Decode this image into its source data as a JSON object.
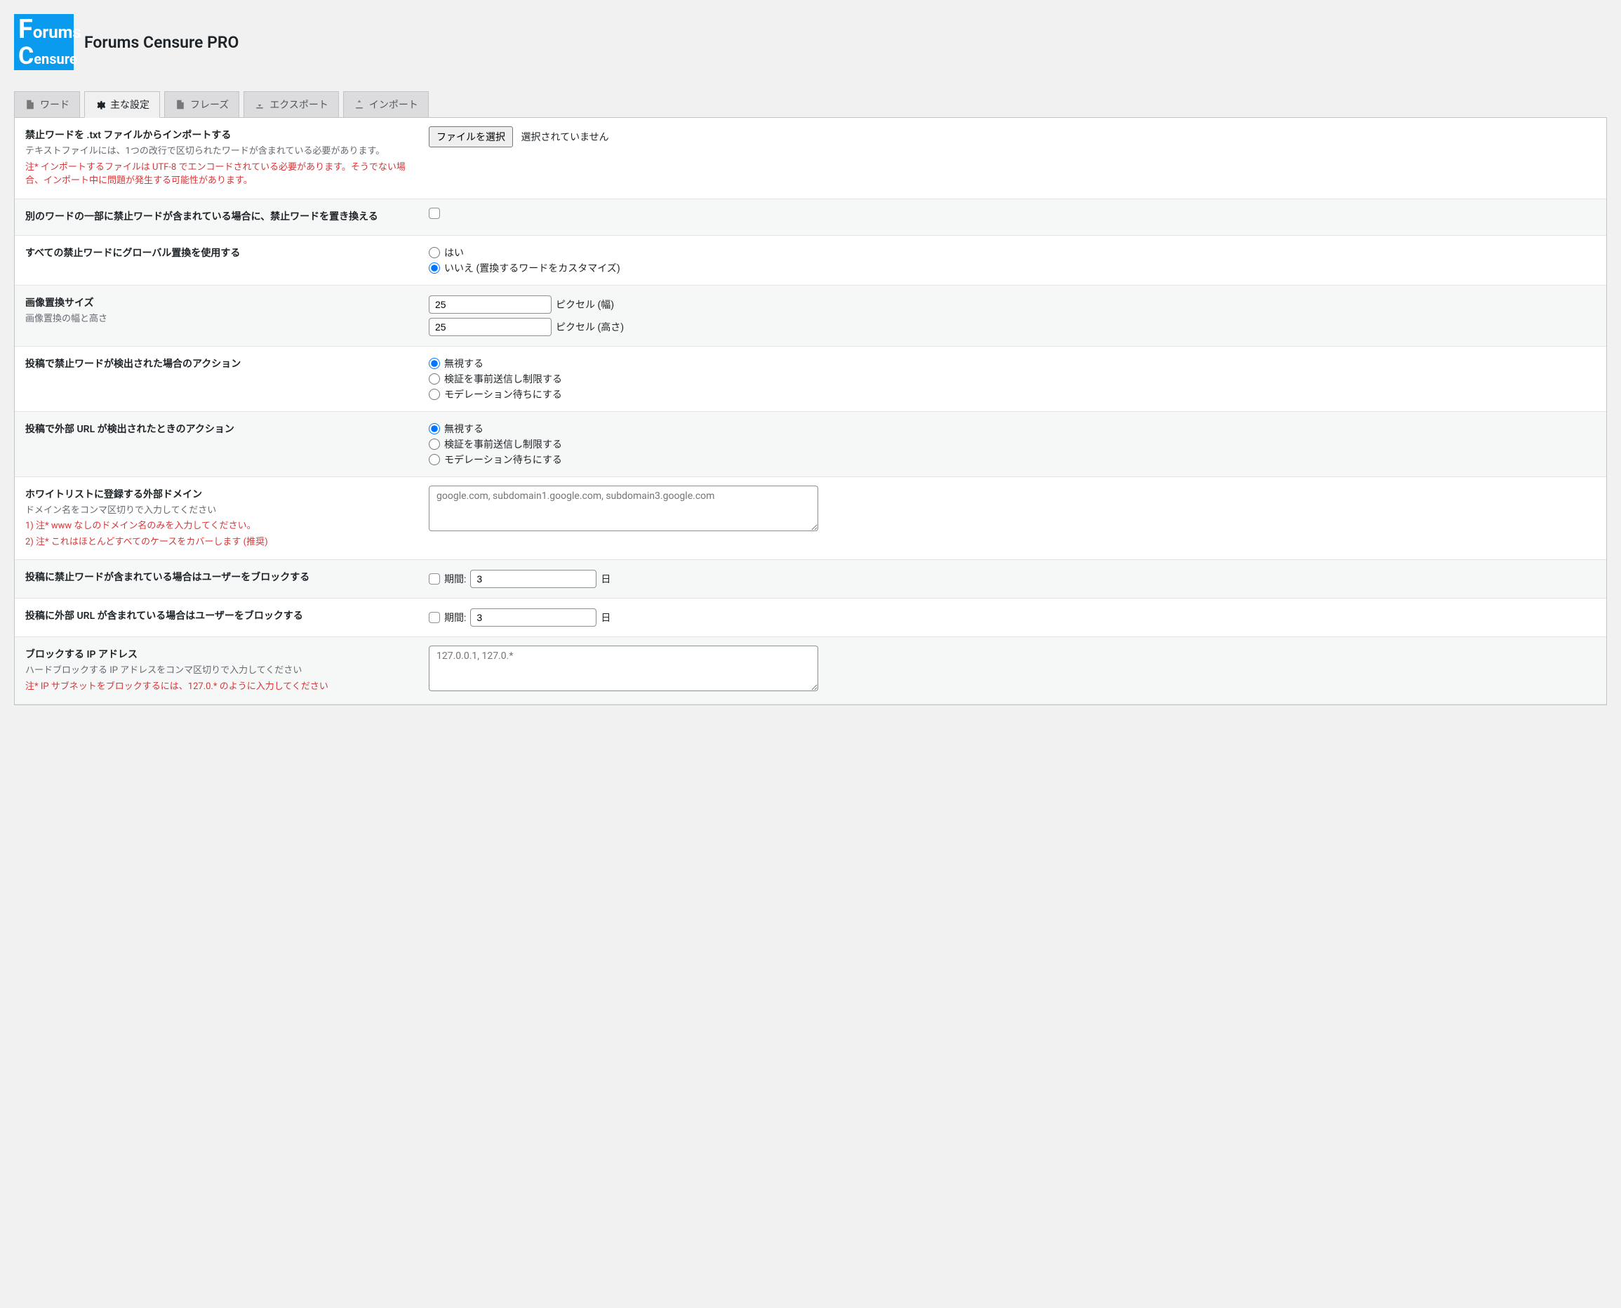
{
  "header": {
    "title": "Forums Censure PRO",
    "logo_top": "orums",
    "logo_top_cap": "F",
    "logo_bottom": "ensure",
    "logo_bottom_cap": "C"
  },
  "tabs": {
    "words": "ワード",
    "main": "主な設定",
    "phrases": "フレーズ",
    "export": "エクスポート",
    "import": "インポート"
  },
  "rows": {
    "import": {
      "label": "禁止ワードを .txt ファイルからインポートする",
      "desc": "テキストファイルには、1つの改行で区切られたワードが含まれている必要があります。",
      "note": "注* インポートするファイルは UTF-8 でエンコードされている必要があります。そうでない場合、インポート中に問題が発生する可能性があります。",
      "button": "ファイルを選択",
      "status": "選択されていません"
    },
    "replace_substring": {
      "label": "別のワードの一部に禁止ワードが含まれている場合に、禁止ワードを置き換える"
    },
    "global_replace": {
      "label": "すべての禁止ワードにグローバル置換を使用する",
      "yes": "はい",
      "no": "いいえ (置換するワードをカスタマイズ)"
    },
    "image_size": {
      "label": "画像置換サイズ",
      "desc": "画像置換の幅と高さ",
      "width_val": "25",
      "height_val": "25",
      "width_unit": "ピクセル (幅)",
      "height_unit": "ピクセル (高さ)"
    },
    "word_action": {
      "label": "投稿で禁止ワードが検出された場合のアクション",
      "opt1": "無視する",
      "opt2": "検証を事前送信し制限する",
      "opt3": "モデレーション待ちにする"
    },
    "url_action": {
      "label": "投稿で外部 URL が検出されたときのアクション",
      "opt1": "無視する",
      "opt2": "検証を事前送信し制限する",
      "opt3": "モデレーション待ちにする"
    },
    "whitelist": {
      "label": "ホワイトリストに登録する外部ドメイン",
      "desc": "ドメイン名をコンマ区切りで入力してください",
      "note1": "1) 注* www なしのドメイン名のみを入力してください。",
      "note2": "2) 注* これはほとんどすべてのケースをカバーします (推奨)",
      "placeholder": "google.com, subdomain1.google.com, subdomain3.google.com"
    },
    "block_word": {
      "label": "投稿に禁止ワードが含まれている場合はユーザーをブロックする",
      "period": "期間:",
      "value": "3",
      "unit": "日"
    },
    "block_url": {
      "label": "投稿に外部 URL が含まれている場合はユーザーをブロックする",
      "period": "期間:",
      "value": "3",
      "unit": "日"
    },
    "block_ip": {
      "label": "ブロックする IP アドレス",
      "desc": "ハードブロックする IP アドレスをコンマ区切りで入力してください",
      "note": "注* IP サブネットをブロックするには、127.0.* のように入力してください",
      "placeholder": "127.0.0.1, 127.0.*"
    }
  }
}
